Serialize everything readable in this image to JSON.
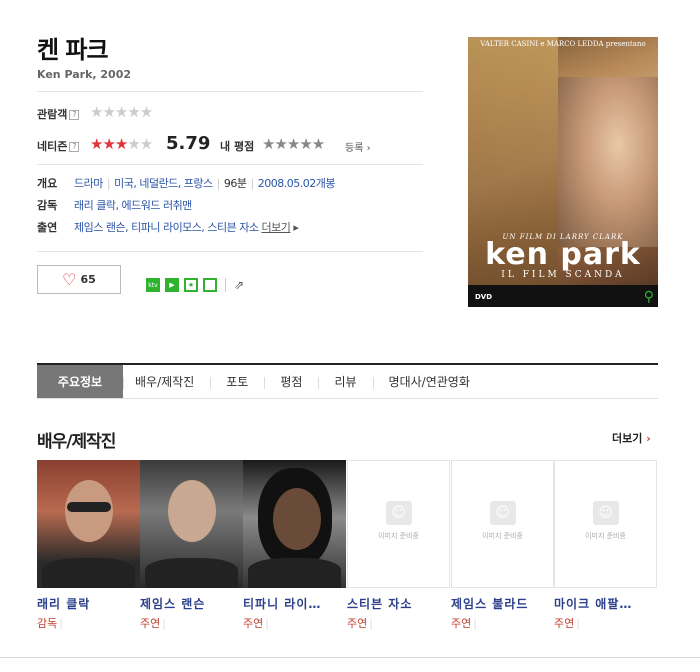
{
  "movie": {
    "title": "켄 파크",
    "subtitle": "Ken Park, 2002"
  },
  "ratings": {
    "audience_label": "관람객",
    "netizen_label": "네티즌",
    "help_mark": "?",
    "netizen_stars": 3,
    "netizen_score": "5.79",
    "my_rating_label": "내 평점",
    "register_label": "등록",
    "star_glyphs": "★★★★★"
  },
  "info": {
    "overview_label": "개요",
    "genre": "드라마",
    "country": "미국, 네덜란드, 프랑스",
    "runtime": "96분",
    "release": "2008.05.02개봉",
    "director_label": "감독",
    "director": "래리 클락, 에드워드 러취맨",
    "cast_label": "출연",
    "cast": "제임스 랜슨, 티파니 라이모스, 스티븐 자소",
    "more_label": "더보기"
  },
  "actions": {
    "like_count": "65",
    "badge_text": "ktv"
  },
  "poster": {
    "credit": "VALTER CASINI e MARCO LEDDA presentano",
    "byline": "UN FILM DI LARRY CLARK",
    "logo": "ken park",
    "tagline": "IL FILM SCANDA",
    "dvd": "DVD"
  },
  "tabs": [
    {
      "label": "주요정보",
      "active": true
    },
    {
      "label": "배우/제작진",
      "active": false
    },
    {
      "label": "포토",
      "active": false
    },
    {
      "label": "평점",
      "active": false
    },
    {
      "label": "리뷰",
      "active": false
    },
    {
      "label": "명대사/연관영화",
      "active": false
    }
  ],
  "cast_section": {
    "title": "배우/제작진",
    "more_label": "더보기",
    "no_image_text": "이미지 준비중",
    "people": [
      {
        "name": "래리 클락",
        "role": "감독"
      },
      {
        "name": "제임스 랜슨",
        "role": "주연"
      },
      {
        "name": "티파니 라이…",
        "role": "주연"
      },
      {
        "name": "스티븐 자소",
        "role": "주연"
      },
      {
        "name": "제임스 불라드",
        "role": "주연"
      },
      {
        "name": "마이크 애팔…",
        "role": "주연"
      }
    ]
  },
  "colors": {
    "accent_red": "#e1333a",
    "link_blue": "#2b55a6",
    "active_tab": "#777777",
    "badge_green": "#2fb32f"
  }
}
